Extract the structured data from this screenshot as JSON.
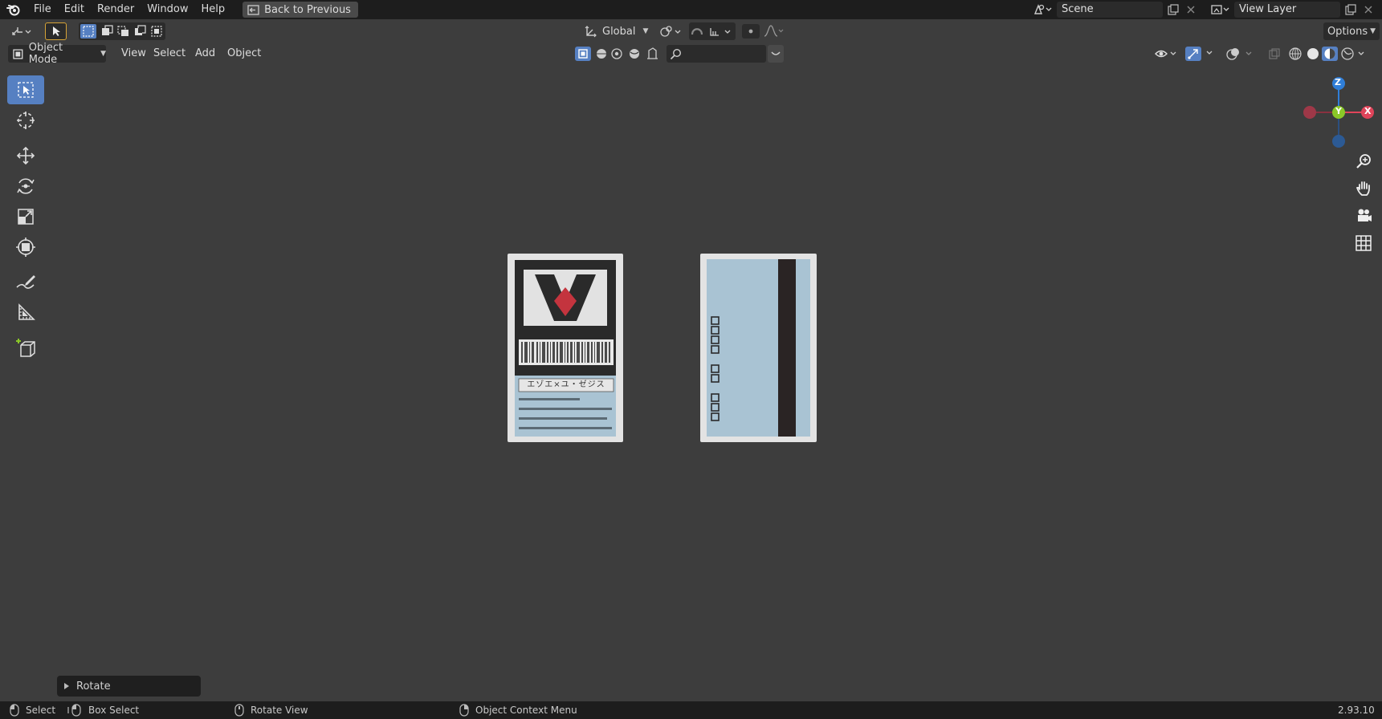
{
  "menu": {
    "items": [
      "File",
      "Edit",
      "Render",
      "Window",
      "Help"
    ],
    "back_label": "Back to Previous"
  },
  "scene": {
    "value": "Scene"
  },
  "view_layer": {
    "value": "View Layer"
  },
  "header": {
    "orientation": "Global",
    "options_label": "Options",
    "mode": "Object Mode",
    "view_menu": [
      "View",
      "Select",
      "Add",
      "Object"
    ]
  },
  "gizmo": {
    "z": "Z",
    "y": "Y",
    "x": "X"
  },
  "card_front": {
    "katakana": "エゾエ×ユ・ゼジス"
  },
  "operator_panel": {
    "label": "Rotate"
  },
  "status": {
    "select": "Select",
    "box_select": "Box Select",
    "rotate_view": "Rotate View",
    "context_menu": "Object Context Menu",
    "version": "2.93.10"
  },
  "colors": {
    "viewport_bg": "#3d3d3d",
    "active_tool": "#5680c2",
    "axis_x": "#e0445a",
    "axis_y": "#8bc828",
    "axis_z": "#2f7ed8",
    "card_face": "#a9c3d3"
  }
}
